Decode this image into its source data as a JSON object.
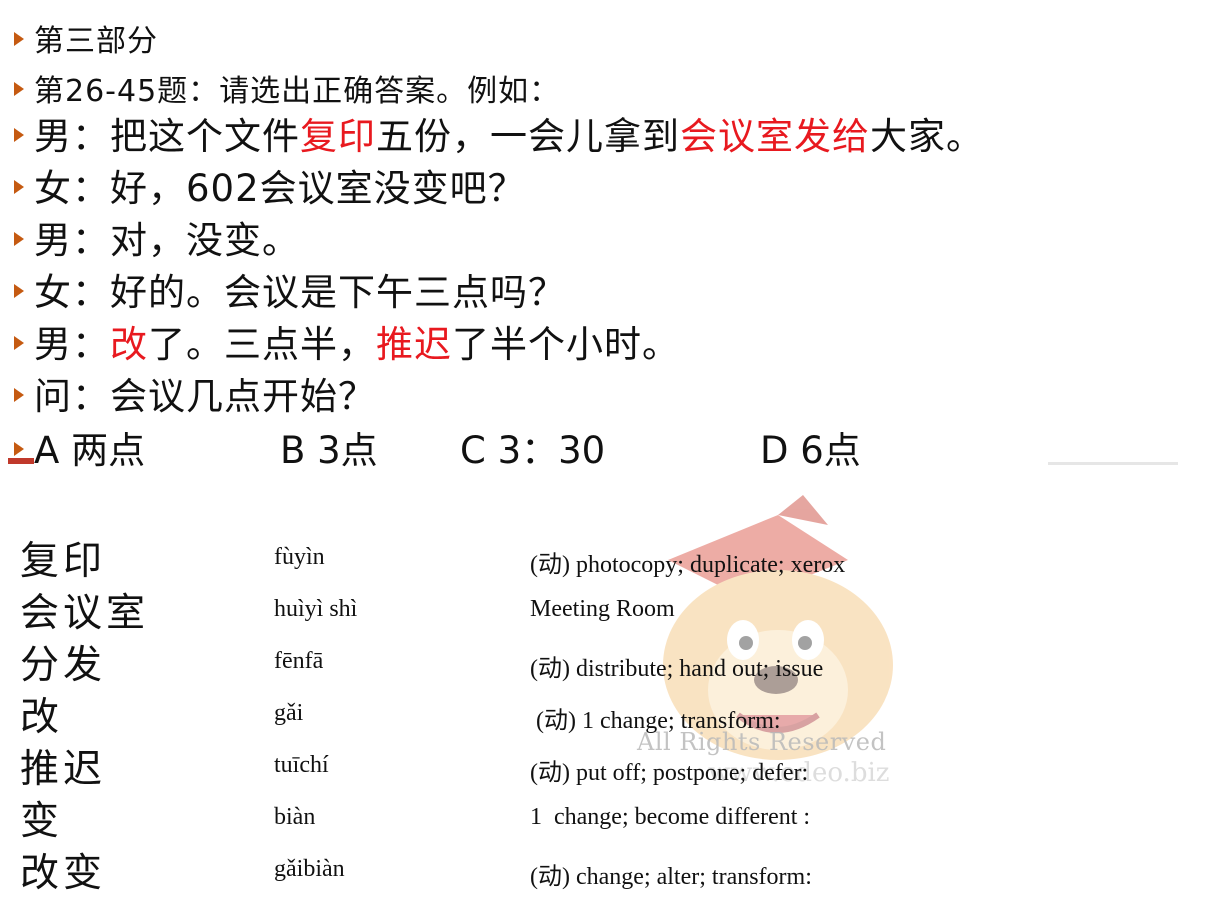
{
  "section": {
    "heading": "第三部分",
    "instruction": "第26-45题：请选出正确答案。例如："
  },
  "dialogue": [
    {
      "parts": [
        {
          "text": "男：把这个文件",
          "red": false
        },
        {
          "text": "复印",
          "red": true
        },
        {
          "text": "五份，一会儿拿到",
          "red": false
        },
        {
          "text": "会议室发给",
          "red": true
        },
        {
          "text": "大家。",
          "red": false
        }
      ]
    },
    {
      "parts": [
        {
          "text": "女：好，602会议室没变吧？",
          "red": false
        }
      ]
    },
    {
      "parts": [
        {
          "text": "男：对，没变。",
          "red": false
        }
      ]
    },
    {
      "parts": [
        {
          "text": "女：好的。会议是下午三点吗？",
          "red": false
        }
      ]
    },
    {
      "parts": [
        {
          "text": "男：",
          "red": false
        },
        {
          "text": "改",
          "red": true
        },
        {
          "text": "了。三点半，",
          "red": false
        },
        {
          "text": "推迟",
          "red": true
        },
        {
          "text": "了半个小时。",
          "red": false
        }
      ]
    },
    {
      "parts": [
        {
          "text": "问：会议几点开始？",
          "red": false
        }
      ]
    }
  ],
  "options": [
    "A 两点",
    "B 3点",
    "C 3：30",
    "D 6点"
  ],
  "watermark": {
    "text": "All Rights Reserved",
    "url": "www.edeo.biz"
  },
  "vocabulary": [
    {
      "hanzi": "复印",
      "pinyin": "fùyìn",
      "definition": "(动) photocopy; duplicate; xerox"
    },
    {
      "hanzi": "会议室",
      "pinyin": "huìyì shì",
      "definition": "Meeting Room"
    },
    {
      "hanzi": "分发",
      "pinyin": "fēnfā",
      "definition": "(动) distribute; hand out; issue"
    },
    {
      "hanzi": "改",
      "pinyin": "gǎi",
      "definition": " (动) 1 change; transform:"
    },
    {
      "hanzi": "推迟",
      "pinyin": "tuīchí",
      "definition": "(动) put off; postpone; defer:"
    },
    {
      "hanzi": "变",
      "pinyin": "biàn",
      "definition": "1  change; become different :"
    },
    {
      "hanzi": "改变",
      "pinyin": "gǎibiàn",
      "definition": "(动) change; alter; transform:"
    }
  ],
  "colors": {
    "bullet": "#c55a11",
    "highlight": "#e8191f"
  }
}
